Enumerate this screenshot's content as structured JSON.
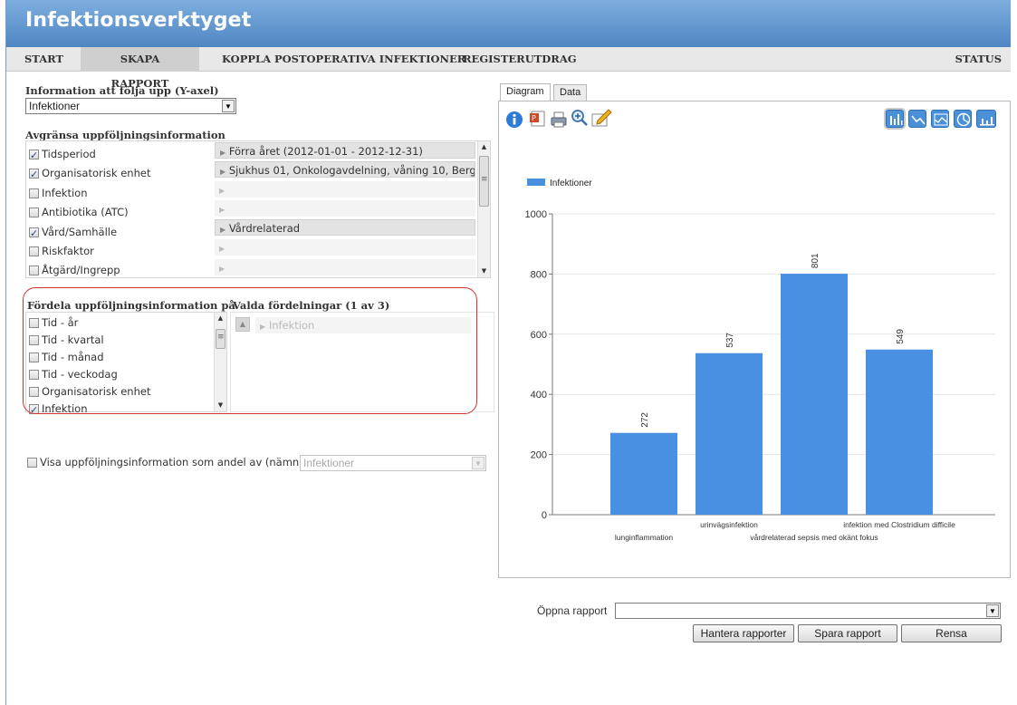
{
  "app_title": "Infektionsverktyget",
  "nav": {
    "items": [
      "START",
      "SKAPA RAPPORT",
      "KOPPLA POSTOPERATIVA INFEKTIONER",
      "REGISTERUTDRAG"
    ],
    "active": "SKAPA RAPPORT",
    "status": "STATUS"
  },
  "yaxis": {
    "label": "Information att följa upp (Y-axel)",
    "selected": "Infektioner"
  },
  "limit": {
    "label": "Avgränsa uppföljningsinformation",
    "rows": [
      {
        "name": "Tidsperiod",
        "checked": true,
        "value": "Förra året (2012-01-01 - 2012-12-31)"
      },
      {
        "name": "Organisatorisk enhet",
        "checked": true,
        "value": "Sjukhus 01, Onkologavdelning, våning 10, Berg"
      },
      {
        "name": "Infektion",
        "checked": false,
        "value": ""
      },
      {
        "name": "Antibiotika (ATC)",
        "checked": false,
        "value": ""
      },
      {
        "name": "Vård/Samhälle",
        "checked": true,
        "value": "Vårdrelaterad"
      },
      {
        "name": "Riskfaktor",
        "checked": false,
        "value": ""
      },
      {
        "name": "Åtgärd/Ingrepp",
        "checked": false,
        "value": ""
      }
    ]
  },
  "distribute": {
    "label": "Fördela uppföljningsinformation på",
    "items": [
      {
        "name": "Tid - år",
        "checked": false
      },
      {
        "name": "Tid - kvartal",
        "checked": false
      },
      {
        "name": "Tid - månad",
        "checked": false
      },
      {
        "name": "Tid - veckodag",
        "checked": false
      },
      {
        "name": "Organisatorisk enhet",
        "checked": false
      },
      {
        "name": "Infektion",
        "checked": true
      }
    ],
    "selected_label": "Valda fördelningar (1 av 3)",
    "selected_items": [
      "Infektion"
    ]
  },
  "share": {
    "label": "Visa uppföljningsinformation som andel av (nämnare)",
    "checked": false,
    "value": "Infektioner"
  },
  "tabs": {
    "diagram": "Diagram",
    "data": "Data",
    "active": "Diagram"
  },
  "toolbar_icons": [
    "info-icon",
    "powerpoint-icon",
    "print-icon",
    "zoom-icon",
    "edit-icon"
  ],
  "chart_types": [
    "bar-chart-icon",
    "line-chart-icon",
    "area-chart-icon",
    "pie-chart-icon",
    "column-chart-icon"
  ],
  "chart_data": {
    "type": "bar",
    "categories": [
      "lunginflammation",
      "urinvägsinfektion",
      "vårdrelaterad sepsis med okänt fokus",
      "infektion med Clostridium difficile"
    ],
    "series": [
      {
        "name": "Infektioner",
        "values": [
          272,
          537,
          801,
          549
        ],
        "color": "#4a90e2"
      }
    ],
    "ylim": [
      0,
      1000
    ],
    "yticks": [
      0,
      200,
      400,
      600,
      800,
      1000
    ],
    "legend": "top-left"
  },
  "report": {
    "open_label": "Öppna rapport",
    "open_value": "",
    "manage_button": "Hantera rapporter",
    "save_button": "Spara rapport",
    "clear_button": "Rensa"
  }
}
